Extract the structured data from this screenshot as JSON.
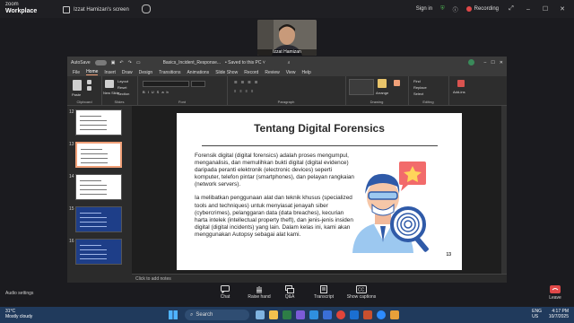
{
  "zoom": {
    "brand_top": "zoom",
    "brand_bottom": "Workplace",
    "screen_title": "Izzat Hamizan's screen",
    "signin": "Sign in",
    "recording": "Recording",
    "participant_name": "Izzat Hamizan"
  },
  "ppt": {
    "autosave": "AutoSave",
    "toggle_state": "Off",
    "doc_title": "Basics_Incident_Response...",
    "saved_status": "• Saved to this PC ˅",
    "menu_tabs": [
      "File",
      "Home",
      "Insert",
      "Draw",
      "Design",
      "Transitions",
      "Animations",
      "Slide Show",
      "Record",
      "Review",
      "View",
      "Help"
    ],
    "ribbon": {
      "clipboard": "Clipboard",
      "paste": "Paste",
      "slides": "Slides",
      "new_slide": "New Slide",
      "layout": "Layout",
      "reset": "Reset",
      "section": "Section",
      "font": "Font",
      "paragraph": "Paragraph",
      "drawing": "Drawing",
      "arrange": "Arrange",
      "editing": "Editing",
      "find": "Find",
      "replace": "Replace",
      "select": "Select",
      "addins": "Add-ins"
    },
    "thumbnails": [
      {
        "num": "12"
      },
      {
        "num": "13"
      },
      {
        "num": "14"
      },
      {
        "num": "15"
      },
      {
        "num": "16"
      }
    ],
    "notes_placeholder": "Click to add notes"
  },
  "slide": {
    "title": "Tentang Digital Forensics",
    "para1": "Forensik digital (digital forensics) adalah proses mengumpul, menganalisis, dan memulihkan bukti digital (digital evidence) daripada peranti elektronik (electronic devices) seperti komputer, telefon pintar (smartphones), dan pelayan rangkaian (network servers).",
    "para2": "Ia melibatkan penggunaan alat dan teknik khusus (specialized tools and techniques) untuk menyiasat jenayah siber (cybercrimes), pelanggaran data (data breaches), kecurian harta intelek (intellectual property theft), dan jenis-jenis insiden digital (digital incidents) yang lain. Dalam kelas ini, kami akan menggunakan Autopsy sebagai alat kami.",
    "number": "13"
  },
  "controls": {
    "audio_settings": "Audio settings",
    "items": [
      "Chat",
      "Raise hand",
      "Q&A",
      "Transcript",
      "Show captions"
    ],
    "leave": "Leave"
  },
  "taskbar": {
    "temp": "31°C",
    "weather": "Mostly cloudy",
    "search": "Search",
    "lang1": "ENG",
    "lang2": "US",
    "time": "4:17 PM",
    "date": "10/7/2025"
  },
  "colors": {
    "accent": "#f0a078",
    "zoom_bg": "#1f1f23",
    "taskbar": "#203a5c",
    "recording": "#e04848"
  }
}
